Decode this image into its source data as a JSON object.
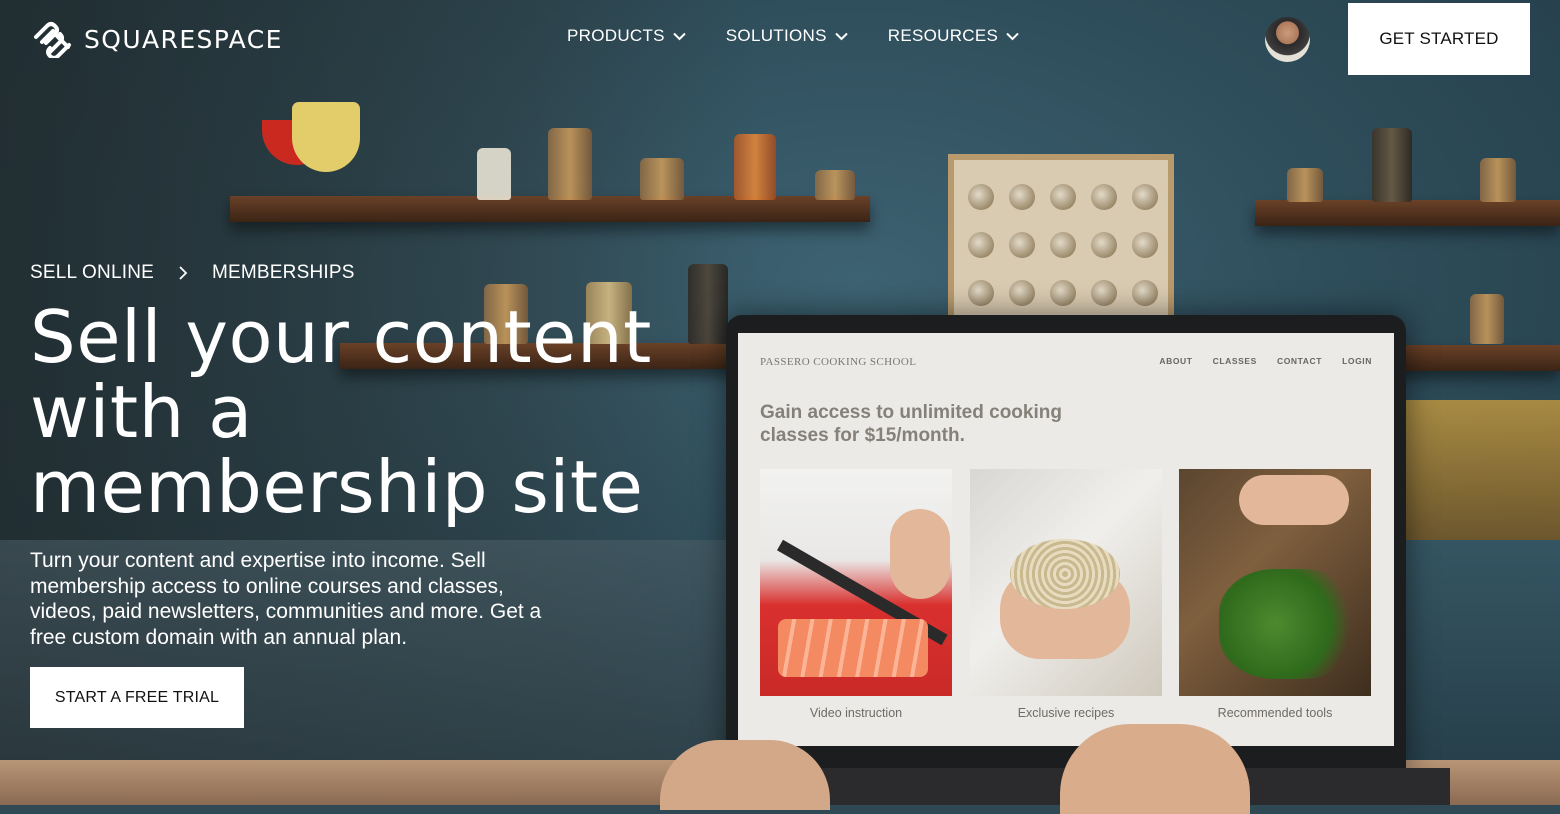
{
  "brand": {
    "name": "SQUARESPACE"
  },
  "nav": [
    {
      "label": "PRODUCTS"
    },
    {
      "label": "SOLUTIONS"
    },
    {
      "label": "RESOURCES"
    }
  ],
  "header": {
    "cta_label": "GET STARTED"
  },
  "breadcrumb": {
    "parent": "SELL ONLINE",
    "current": "MEMBERSHIPS"
  },
  "hero": {
    "headline": "Sell your content with a membership site",
    "subtext": "Turn your content and expertise into income. Sell membership access to online courses and classes, videos, paid newsletters, communities and more. Get a free custom domain with an annual plan.",
    "cta_label": "START A FREE TRIAL"
  },
  "laptop_site": {
    "logo": "PASSERO COOKING SCHOOL",
    "nav": [
      "ABOUT",
      "CLASSES",
      "CONTACT",
      "LOGIN"
    ],
    "headline": "Gain access to unlimited cooking classes for $15/month.",
    "cards": [
      {
        "label": "Video instruction"
      },
      {
        "label": "Exclusive recipes"
      },
      {
        "label": "Recommended tools"
      }
    ]
  },
  "colors": {
    "cta_bg": "#ffffff",
    "text": "#ffffff",
    "scene_wall": "#2f4a55"
  }
}
